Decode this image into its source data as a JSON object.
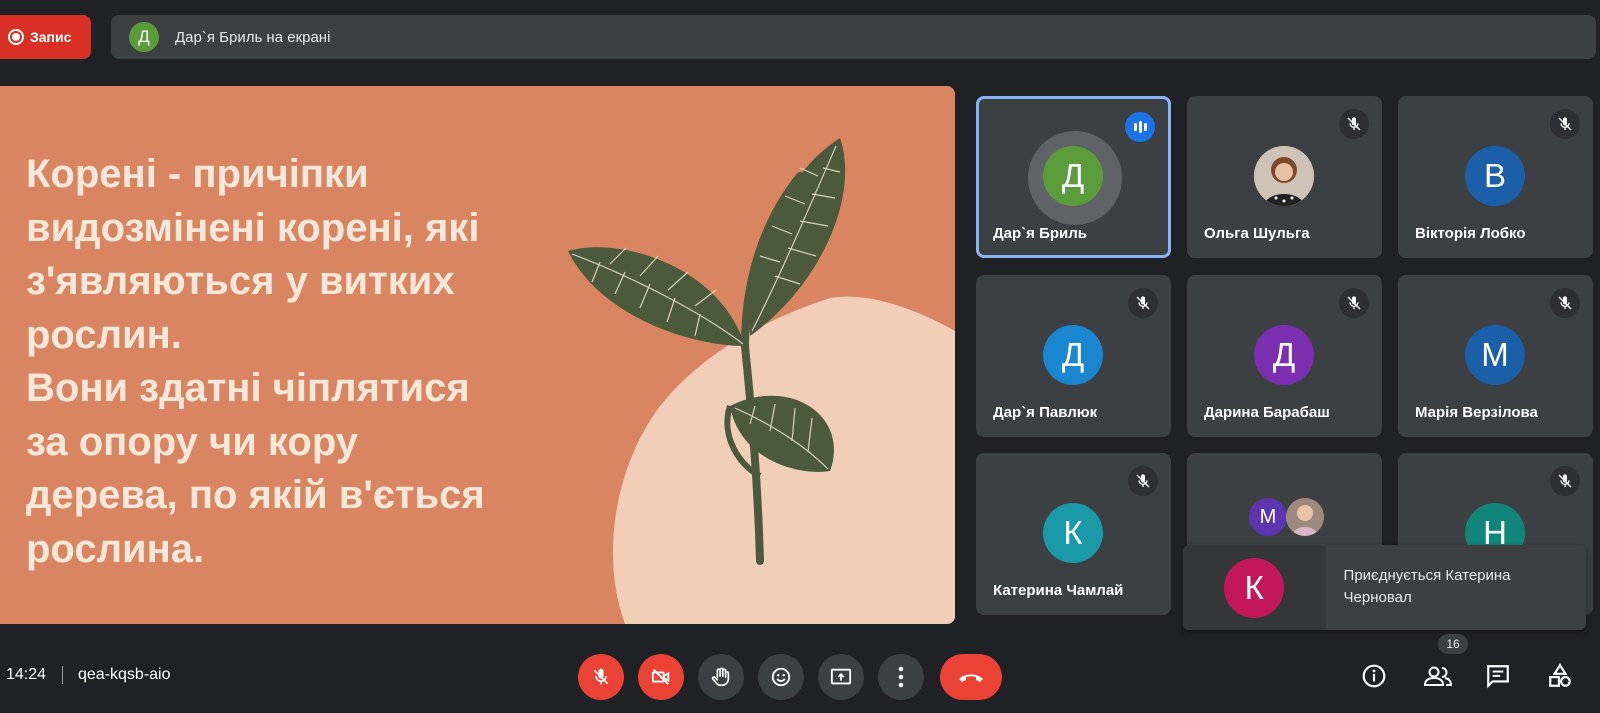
{
  "recording": {
    "label": "Запис",
    "color": "#d93025"
  },
  "presenting": {
    "avatar_letter": "Д",
    "text": "Дар`я Бриль на екрані"
  },
  "slide": {
    "lines": [
      "Корені - причіпки",
      "видозмінені корені, які",
      "з'являються у витких",
      "рослин.",
      "Вони здатні чіплятися",
      "за опору чи кору",
      "дерева, по якій в'ється",
      "рослина."
    ],
    "background": "#d98561"
  },
  "participants": [
    {
      "name": "Дар`я Бриль",
      "letter": "Д",
      "color": "#5a9b3a",
      "status": "speaking",
      "icon": "audio-level-icon"
    },
    {
      "name": "Ольга Шульга",
      "letter": "",
      "color": "#a0a0a0",
      "status": "muted",
      "icon": "mic-off-icon",
      "photo": true
    },
    {
      "name": "Вікторія Лобко",
      "letter": "В",
      "color": "#1a5fa8",
      "status": "muted",
      "icon": "mic-off-icon"
    },
    {
      "name": "Дар`я Павлюк",
      "letter": "Д",
      "color": "#1a86d0",
      "status": "muted",
      "icon": "mic-off-icon"
    },
    {
      "name": "Дарина Барабаш",
      "letter": "Д",
      "color": "#7b2fb0",
      "status": "muted",
      "icon": "mic-off-icon"
    },
    {
      "name": "Марія Верзілова",
      "letter": "М",
      "color": "#1a5fa8",
      "status": "muted",
      "icon": "mic-off-icon"
    },
    {
      "name": "Катерина Чамлай",
      "letter": "К",
      "color": "#1a9aa8",
      "status": "muted",
      "icon": "mic-off-icon"
    },
    {
      "name": "",
      "letter": "М",
      "color": "#5e35b1",
      "status": "group",
      "icon": ""
    },
    {
      "name": "",
      "letter": "Н",
      "color": "#11857a",
      "status": "muted",
      "icon": "mic-off-icon"
    }
  ],
  "toast": {
    "letter": "К",
    "text": "Приєднується Катерина Черновал",
    "color": "#c2185b"
  },
  "meeting": {
    "time": "14:24",
    "code": "qea-kqsb-aio"
  },
  "controls": [
    {
      "name": "mic-off-button",
      "icon": "mic-off-icon"
    },
    {
      "name": "camera-off-button",
      "icon": "camera-off-icon"
    },
    {
      "name": "raise-hand-button",
      "icon": "hand-icon"
    },
    {
      "name": "emoji-button",
      "icon": "emoji-icon"
    },
    {
      "name": "present-button",
      "icon": "present-icon"
    },
    {
      "name": "more-options-button",
      "icon": "more-vert-icon"
    },
    {
      "name": "end-call-button",
      "icon": "end-call-icon"
    }
  ],
  "right_controls": {
    "people_count": "16",
    "icons": [
      "info-icon",
      "people-icon",
      "chat-icon",
      "activities-icon"
    ]
  }
}
